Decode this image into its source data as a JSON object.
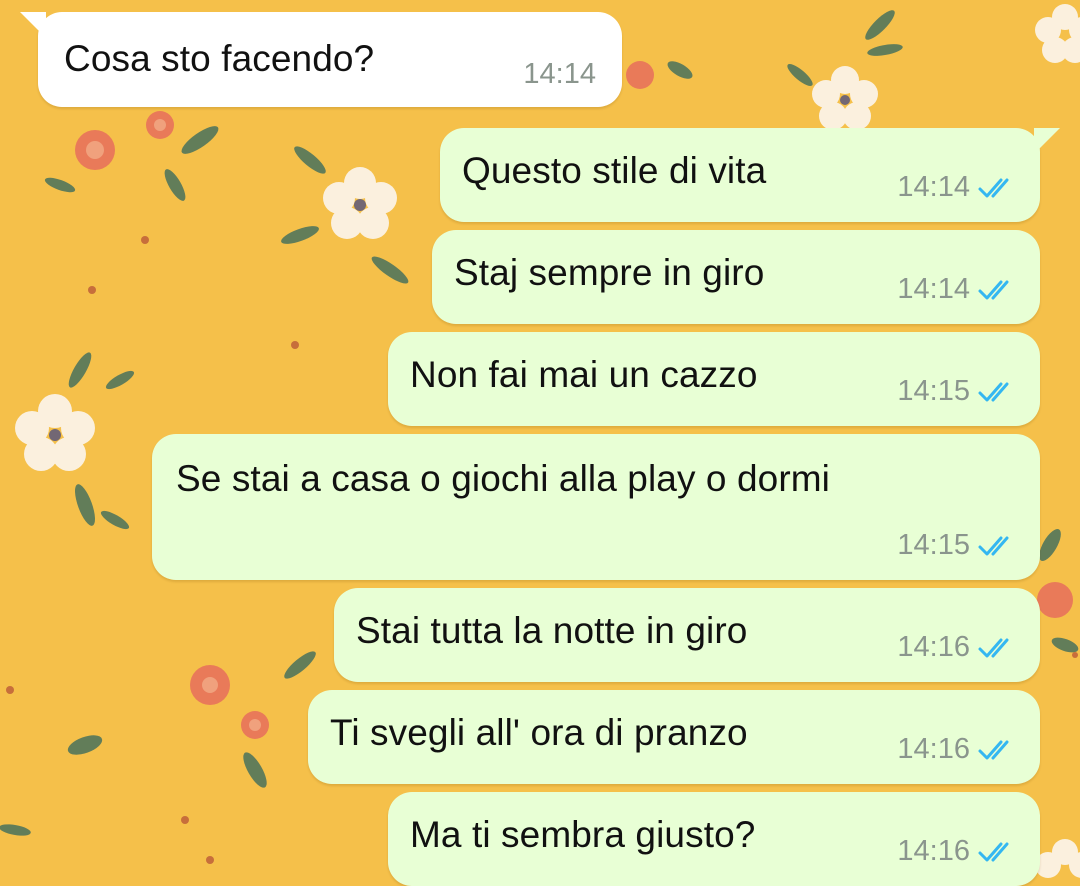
{
  "chat": {
    "colors": {
      "wallpaper": "#f5c04a",
      "incoming_bubble": "#ffffff",
      "outgoing_bubble": "#e8ffd5",
      "time_text": "#8a958d",
      "read_check": "#34b7f1"
    },
    "messages": [
      {
        "direction": "incoming",
        "text": "Cosa sto facendo?",
        "time": "14:14"
      },
      {
        "direction": "outgoing",
        "text": "Questo stile di vita",
        "time": "14:14",
        "status_icon": "double-check-read-icon"
      },
      {
        "direction": "outgoing",
        "text": "Staj sempre in giro",
        "time": "14:14",
        "status_icon": "double-check-read-icon"
      },
      {
        "direction": "outgoing",
        "text": "Non fai mai un cazzo",
        "time": "14:15",
        "status_icon": "double-check-read-icon"
      },
      {
        "direction": "outgoing",
        "text": "Se stai a casa o giochi alla play o dormi",
        "time": "14:15",
        "status_icon": "double-check-read-icon"
      },
      {
        "direction": "outgoing",
        "text": "Stai tutta la notte in giro",
        "time": "14:16",
        "status_icon": "double-check-read-icon"
      },
      {
        "direction": "outgoing",
        "text": "Ti svegli all' ora di pranzo",
        "time": "14:16",
        "status_icon": "double-check-read-icon"
      },
      {
        "direction": "outgoing",
        "text": "Ma ti sembra giusto?",
        "time": "14:16",
        "status_icon": "double-check-read-icon"
      }
    ]
  }
}
